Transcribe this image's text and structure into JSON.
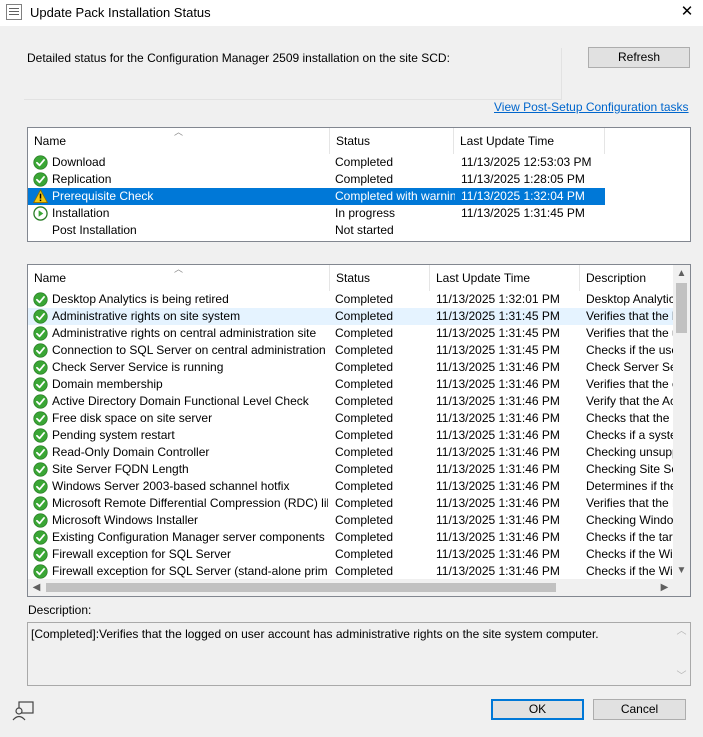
{
  "window": {
    "title": "Update Pack Installation Status",
    "close_glyph": "✕"
  },
  "header": {
    "detail_label": "Detailed status for the Configuration Manager 2509 installation on the site SCD:",
    "refresh_label": "Refresh",
    "post_setup_link": "View Post-Setup Configuration tasks"
  },
  "stages": {
    "columns": [
      "Name",
      "Status",
      "Last Update Time"
    ],
    "rows": [
      {
        "name": "Download",
        "status": "Completed",
        "time": "11/13/2025 12:53:03 PM",
        "icon": "check-icon"
      },
      {
        "name": "Replication",
        "status": "Completed",
        "time": "11/13/2025 1:28:05 PM",
        "icon": "check-icon"
      },
      {
        "name": "Prerequisite Check",
        "status": "Completed with warning",
        "time": "11/13/2025 1:32:04 PM",
        "icon": "warning-icon",
        "selected": true
      },
      {
        "name": "Installation",
        "status": "In progress",
        "time": "11/13/2025 1:31:45 PM",
        "icon": "in-progress-icon"
      },
      {
        "name": "Post Installation",
        "status": "Not started",
        "time": "",
        "icon": "none"
      }
    ]
  },
  "checks": {
    "columns": [
      "Name",
      "Status",
      "Last Update Time",
      "Description"
    ],
    "rows": [
      {
        "name": "Desktop Analytics is being retired",
        "status": "Completed",
        "time": "11/13/2025 1:32:01 PM",
        "desc": "Desktop Analytics"
      },
      {
        "name": "Administrative rights on site system",
        "status": "Completed",
        "time": "11/13/2025 1:31:45 PM",
        "desc": "Verifies that the log",
        "highlight": true
      },
      {
        "name": "Administrative rights on central administration site",
        "status": "Completed",
        "time": "11/13/2025 1:31:45 PM",
        "desc": "Verifies that the us"
      },
      {
        "name": "Connection to SQL Server on central administration site",
        "status": "Completed",
        "time": "11/13/2025 1:31:45 PM",
        "desc": "Checks if the user"
      },
      {
        "name": "Check Server Service is running",
        "status": "Completed",
        "time": "11/13/2025 1:31:46 PM",
        "desc": "Check Server Serv"
      },
      {
        "name": "Domain membership",
        "status": "Completed",
        "time": "11/13/2025 1:31:46 PM",
        "desc": "Verifies that the co"
      },
      {
        "name": "Active Directory Domain Functional Level Check",
        "status": "Completed",
        "time": "11/13/2025 1:31:46 PM",
        "desc": "Verify that the Acti"
      },
      {
        "name": "Free disk space on site server",
        "status": "Completed",
        "time": "11/13/2025 1:31:46 PM",
        "desc": "Checks that the sit"
      },
      {
        "name": "Pending system restart",
        "status": "Completed",
        "time": "11/13/2025 1:31:46 PM",
        "desc": "Checks if a system"
      },
      {
        "name": "Read-Only Domain Controller",
        "status": "Completed",
        "time": "11/13/2025 1:31:46 PM",
        "desc": "Checking unsuppo"
      },
      {
        "name": "Site Server FQDN Length",
        "status": "Completed",
        "time": "11/13/2025 1:31:46 PM",
        "desc": "Checking Site Serv"
      },
      {
        "name": "Windows Server 2003-based schannel hotfix",
        "status": "Completed",
        "time": "11/13/2025 1:31:46 PM",
        "desc": "Determines if the W"
      },
      {
        "name": "Microsoft Remote Differential Compression (RDC) library r...",
        "status": "Completed",
        "time": "11/13/2025 1:31:46 PM",
        "desc": "Verifies that the Mi"
      },
      {
        "name": "Microsoft Windows Installer",
        "status": "Completed",
        "time": "11/13/2025 1:31:46 PM",
        "desc": "Checking Window"
      },
      {
        "name": "Existing Configuration Manager server components on sit...",
        "status": "Completed",
        "time": "11/13/2025 1:31:46 PM",
        "desc": "Checks if the targe"
      },
      {
        "name": "Firewall exception for SQL Server",
        "status": "Completed",
        "time": "11/13/2025 1:31:46 PM",
        "desc": "Checks if the Wind"
      },
      {
        "name": "Firewall exception for SQL Server (stand-alone primary site)",
        "status": "Completed",
        "time": "11/13/2025 1:31:46 PM",
        "desc": "Checks if the Wind"
      }
    ]
  },
  "description": {
    "label": "Description:",
    "text": "[Completed]:Verifies that the logged on user account has administrative rights on the site system computer."
  },
  "footer": {
    "ok_label": "OK",
    "cancel_label": "Cancel"
  },
  "colors": {
    "selection": "#0078d7",
    "hover_row": "#e5f3ff",
    "check_green": "#3aa635",
    "warning_yellow": "#f2c811",
    "link": "#0066cc"
  }
}
